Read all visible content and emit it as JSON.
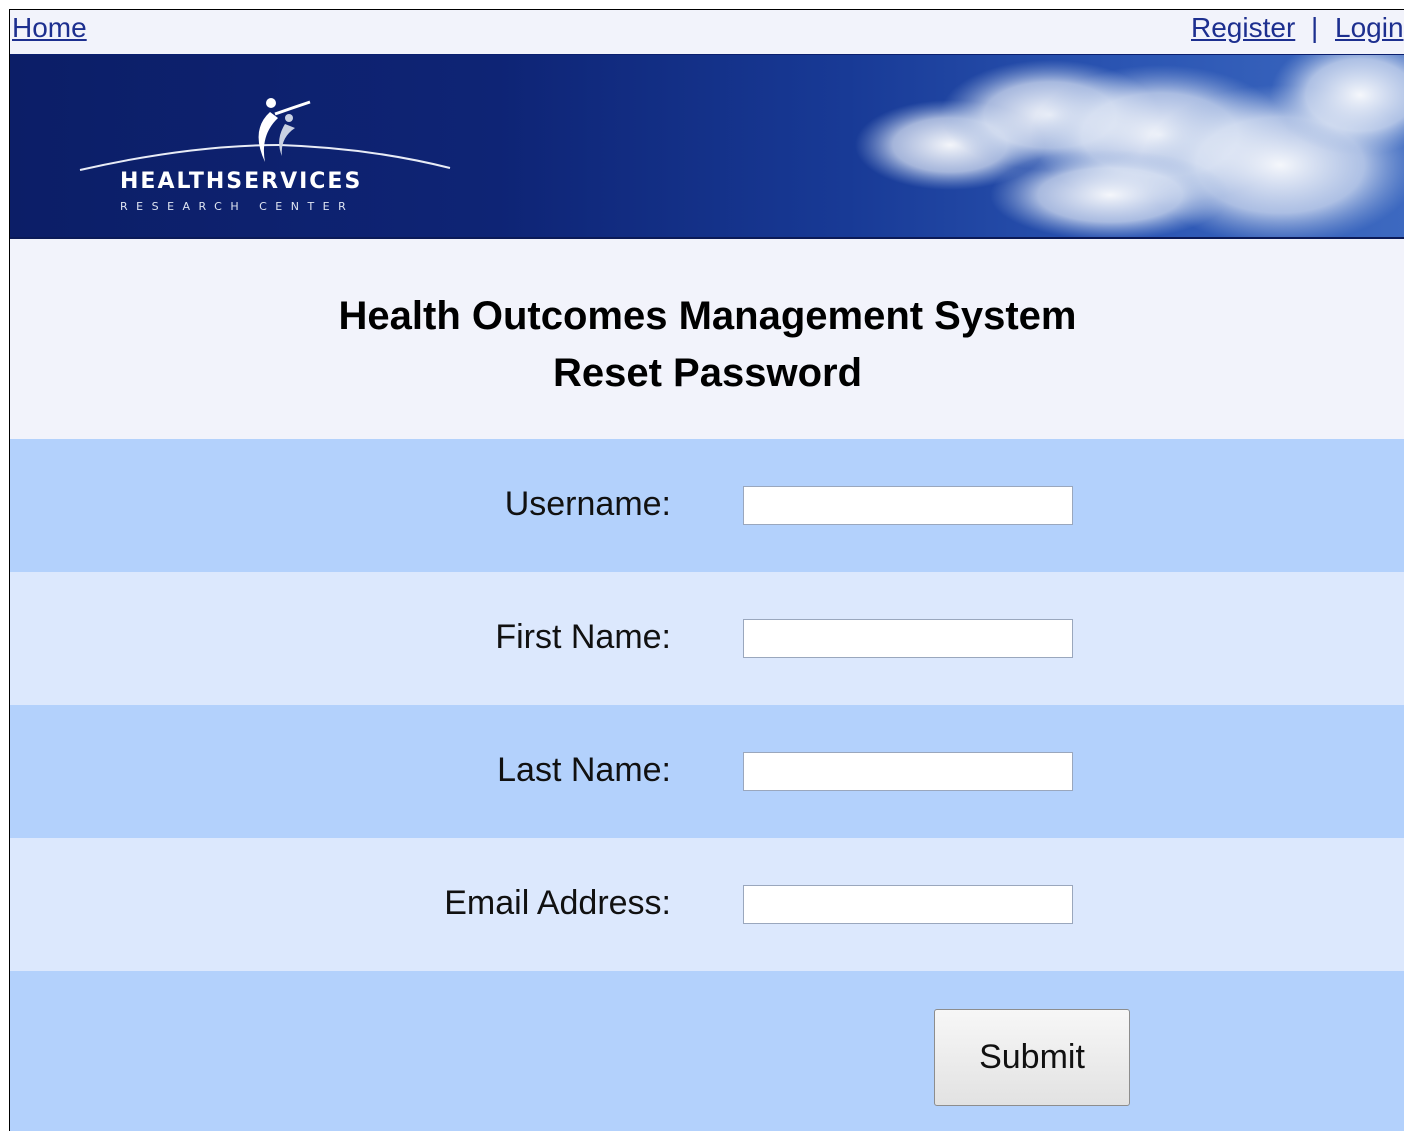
{
  "nav": {
    "home": "Home",
    "register": "Register",
    "separator": "|",
    "login": "Login"
  },
  "banner": {
    "logo_line1": "HEALTHSERVICES",
    "logo_line2": "RESEARCH CENTER"
  },
  "page": {
    "title": "Health Outcomes Management System",
    "subtitle": "Reset Password"
  },
  "form": {
    "fields": [
      {
        "label": "Username:",
        "value": ""
      },
      {
        "label": "First Name:",
        "value": ""
      },
      {
        "label": "Last Name:",
        "value": ""
      },
      {
        "label": "Email Address:",
        "value": ""
      }
    ],
    "submit_label": "Submit"
  },
  "colors": {
    "link": "#1d2f8f",
    "row_dark": "#b3d1fc",
    "row_light": "#dce8fd",
    "banner": "#0e2475"
  }
}
